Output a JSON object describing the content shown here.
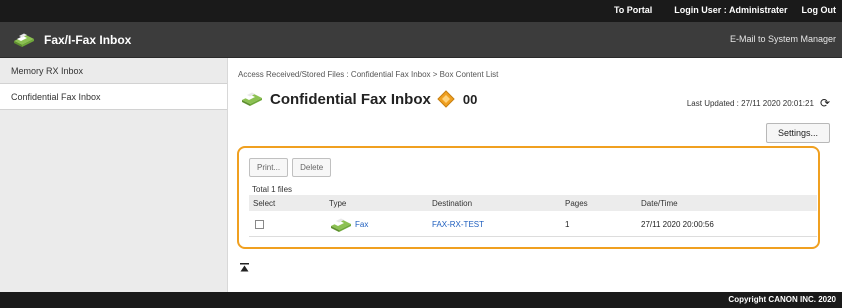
{
  "topbar": {
    "portal_link": "To Portal",
    "login_label": "Login User :",
    "login_user": "Administrater",
    "logout_link": "Log Out"
  },
  "header": {
    "title": "Fax/I-Fax Inbox",
    "email_link": "E-Mail to System Manager",
    "icon": "fax-machine-icon"
  },
  "sidebar": {
    "items": [
      {
        "label": "Memory RX Inbox",
        "active": false
      },
      {
        "label": "Confidential Fax Inbox",
        "active": true
      }
    ]
  },
  "main": {
    "breadcrumb": "Access Received/Stored Files : Confidential Fax Inbox > Box Content List",
    "page_title": "Confidential Fax Inbox",
    "box_number": "00",
    "box_icon": "diamond-box-icon",
    "last_updated": "Last Updated : 27/11 2020 20:01:21",
    "refresh_icon": "refresh-icon",
    "settings_button": "Settings..."
  },
  "panel": {
    "print_button": "Print...",
    "delete_button": "Delete",
    "total_files": "Total 1 files",
    "columns": [
      "Select",
      "Type",
      "Destination",
      "Pages",
      "Date/Time"
    ],
    "rows": [
      {
        "type": "Fax",
        "destination": "FAX-RX-TEST",
        "pages": "1",
        "datetime": "27/11 2020 20:00:56",
        "selected": false
      }
    ]
  },
  "scroll_top_icon": "scroll-to-top-icon",
  "footer": {
    "copyright": "Copyright CANON INC. 2020"
  },
  "colors": {
    "accent_orange": "#f0a020",
    "link_blue": "#1f5fbf",
    "topbar_bg": "#1a1a1a",
    "header_bg": "#3c3c3c"
  }
}
